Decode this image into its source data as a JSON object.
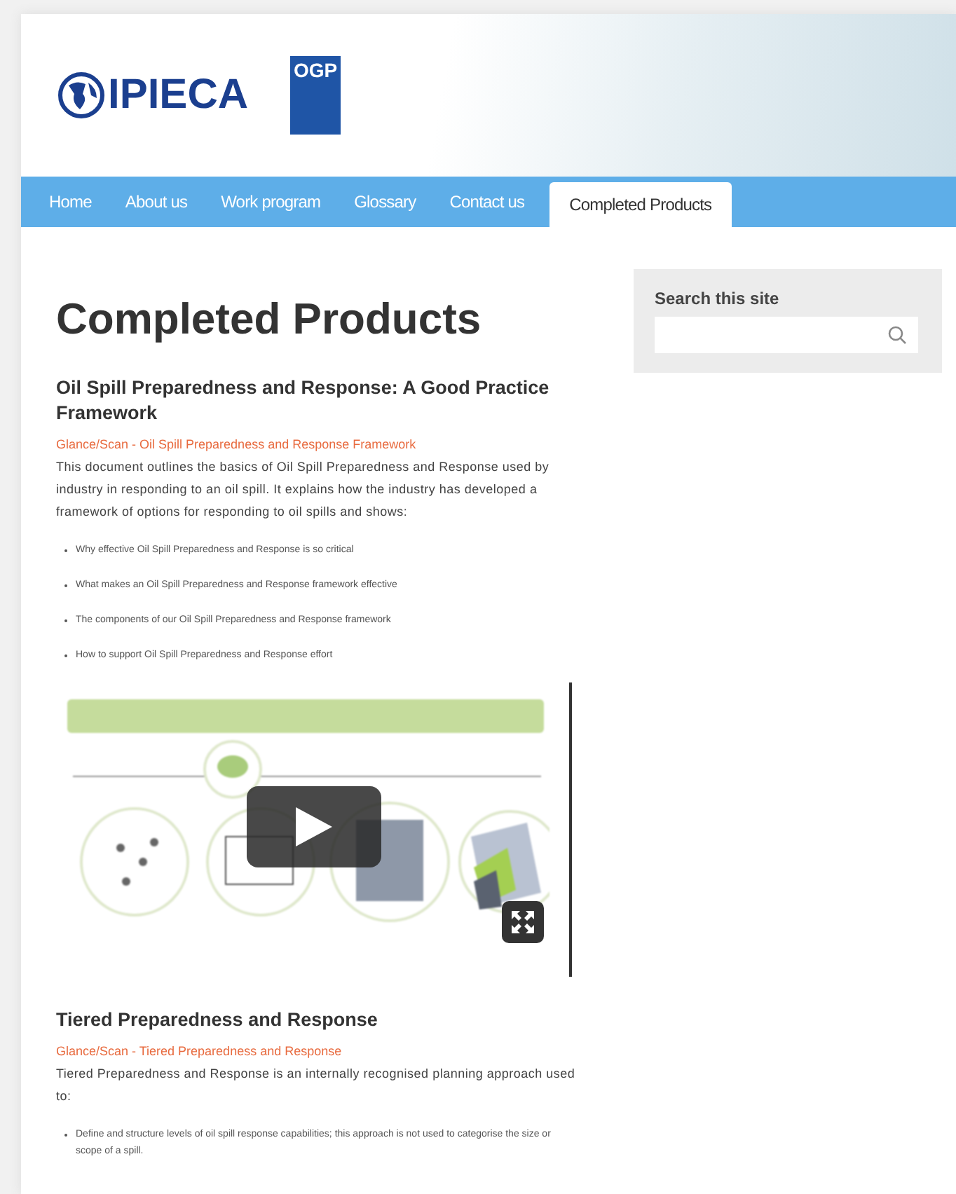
{
  "header": {
    "logo_text": "IPIECA",
    "badge_text": "OGP"
  },
  "nav": [
    {
      "label": "Home",
      "selected": false
    },
    {
      "label": "About us",
      "selected": false
    },
    {
      "label": "Work program",
      "selected": false
    },
    {
      "label": "Glossary",
      "selected": false
    },
    {
      "label": "Contact us",
      "selected": false
    },
    {
      "label": "Completed Products",
      "selected": true
    }
  ],
  "page_title": "Completed Products",
  "sections": [
    {
      "heading": "Oil Spill Preparedness and Response: A Good Practice Framework",
      "link": "Glance/Scan - Oil Spill Preparedness and Response Framework",
      "text": "This document outlines the basics of Oil Spill Preparedness and Response used by industry in responding to an oil spill. It explains how the industry has developed a framework of options for responding to oil spills and shows:",
      "bullets": [
        "Why effective Oil Spill Preparedness and Response is so critical",
        "What makes an Oil Spill Preparedness and Response framework effective",
        "The components of our Oil Spill Preparedness and Response framework",
        "How to support Oil Spill Preparedness and Response effort"
      ]
    },
    {
      "heading": "Tiered Preparedness and Response",
      "link": "Glance/Scan - Tiered Preparedness and Response",
      "text": "Tiered Preparedness and Response is an internally recognised planning approach used to:",
      "bullets": [
        "Define and structure levels of oil spill response capabilities; this approach is not used to categorise the size or scope of a spill."
      ]
    }
  ],
  "sidebar": {
    "search_title": "Search this site"
  }
}
